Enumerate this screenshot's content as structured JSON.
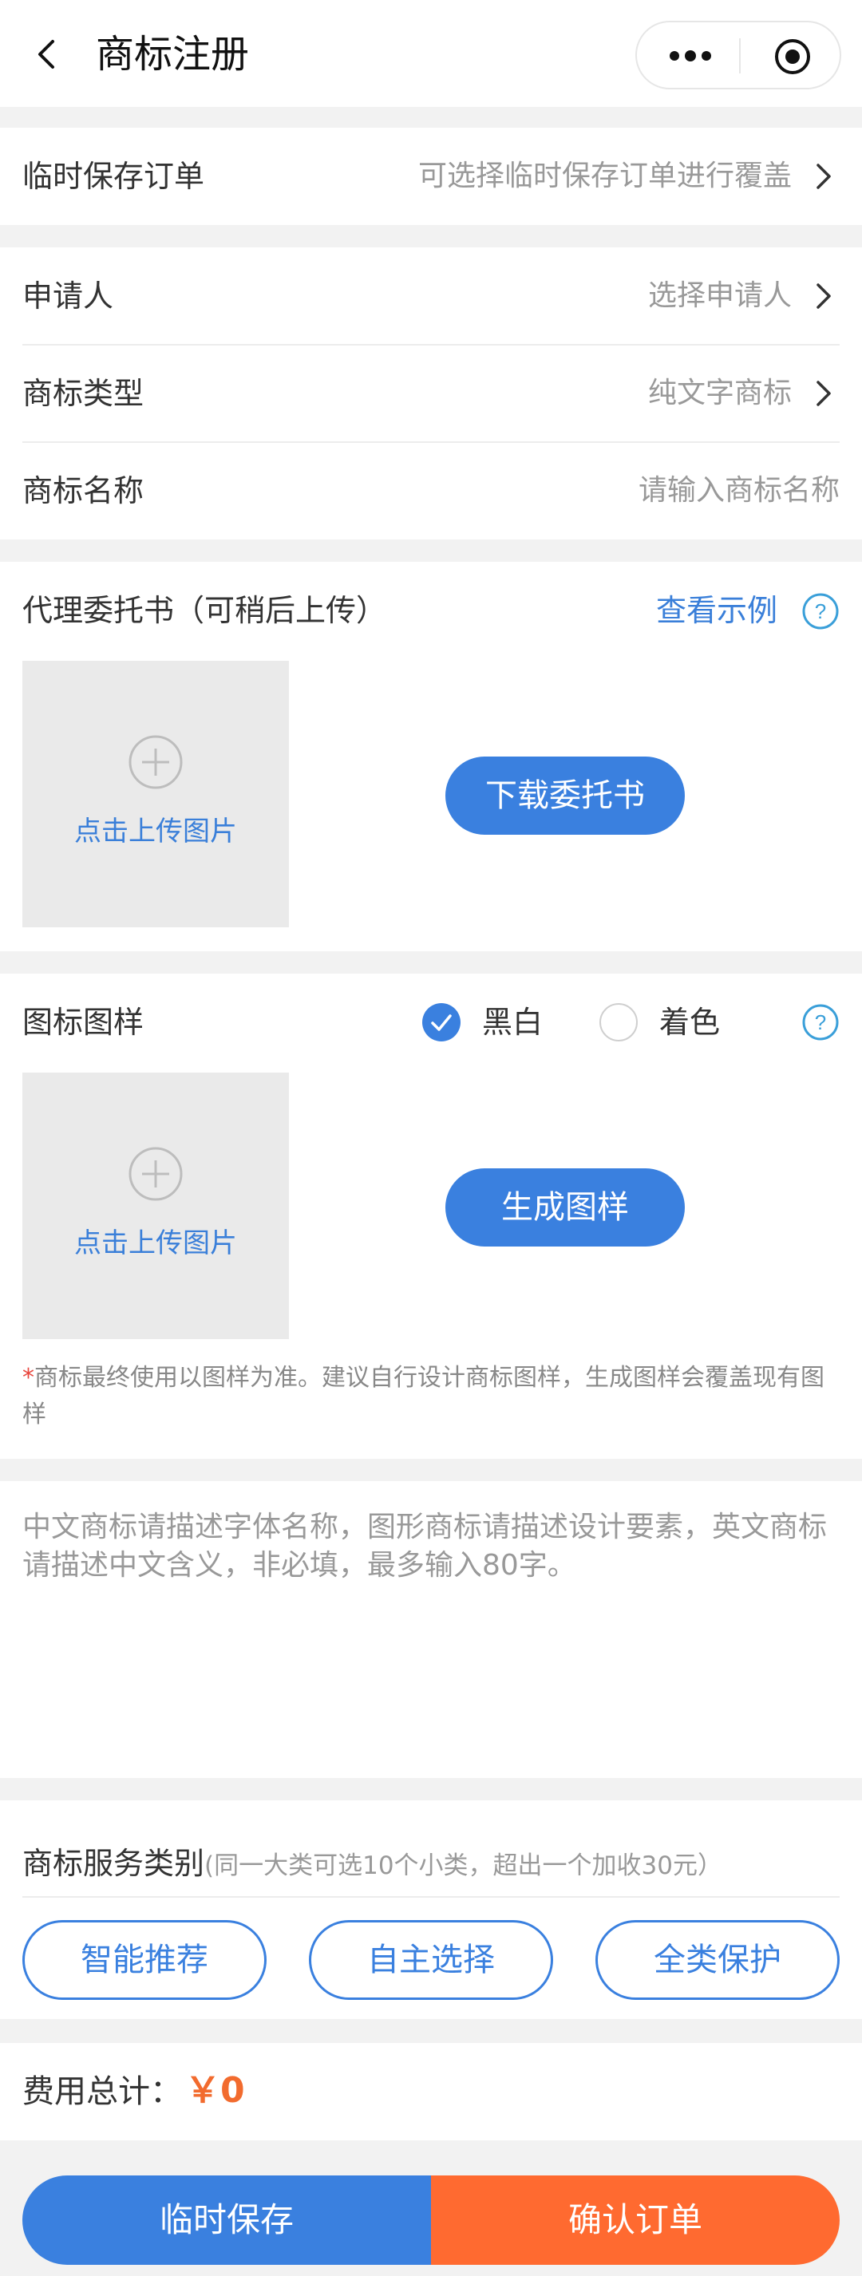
{
  "header": {
    "title": "商标注册"
  },
  "temp_order": {
    "label": "临时保存订单",
    "value": "可选择临时保存订单进行覆盖"
  },
  "fields": {
    "applicant": {
      "label": "申请人",
      "value": "选择申请人"
    },
    "trademark_type": {
      "label": "商标类型",
      "value": "纯文字商标"
    },
    "trademark_name": {
      "label": "商标名称",
      "placeholder": "请输入商标名称"
    }
  },
  "proxy": {
    "title": "代理委托书（可稍后上传）",
    "view_example": "查看示例",
    "upload_label": "点击上传图片",
    "download_button": "下载委托书"
  },
  "logo": {
    "title": "图标图样",
    "option_bw": "黑白",
    "option_color": "着色",
    "selected": "黑白",
    "upload_label": "点击上传图片",
    "generate_button": "生成图样",
    "note_star": "*",
    "note": "商标最终使用以图样为准。建议自行设计商标图样，生成图样会覆盖现有图样"
  },
  "description": {
    "placeholder": "中文商标请描述字体名称，图形商标请描述设计要素，英文商标请描述中文含义，非必填，最多输入80字。"
  },
  "service": {
    "title": "商标服务类别",
    "subtitle": "(同一大类可选10个小类，超出一个加收30元）",
    "buttons": [
      "智能推荐",
      "自主选择",
      "全类保护"
    ]
  },
  "total": {
    "label": "费用总计：",
    "amount": "￥0"
  },
  "actions": {
    "save": "临时保存",
    "confirm": "确认订单"
  },
  "colors": {
    "primary": "#3a80df",
    "accent": "#ff6a30",
    "price": "#f26b2e"
  }
}
